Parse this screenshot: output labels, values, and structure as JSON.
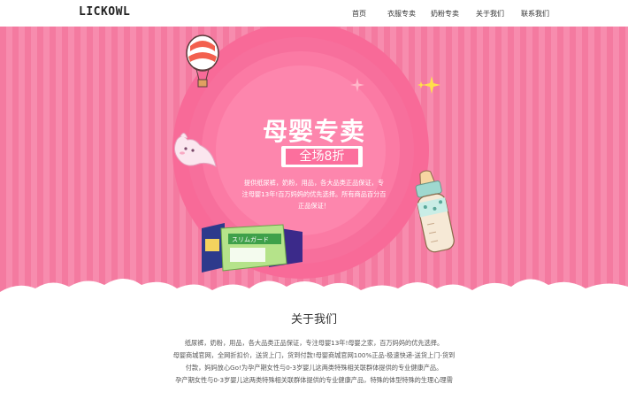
{
  "header": {
    "logo": "LICKOWL",
    "nav": [
      {
        "label": "首页"
      },
      {
        "label": "衣服专卖"
      },
      {
        "label": "奶粉专卖"
      },
      {
        "label": "关于我们"
      },
      {
        "label": "联系我们"
      }
    ]
  },
  "hero": {
    "title": "母婴专卖",
    "promo": "全场8折",
    "description": [
      "提供纸尿裤，奶粉，用品，各大品类正品保证，专",
      "注母婴13年!百万妈妈的优先选择。所有商品百分百",
      "正品保证！"
    ],
    "product_box_text": "スリムガード"
  },
  "about": {
    "title": "关于我们",
    "lines": [
      "纸尿裤，奶粉，用品，各大品类正品保证，专注母婴13年!母婴之家，百万妈妈的优先选择。",
      "母婴商城官网，全网折扣价，送货上门，货到付款!母婴商城官网100%正品-极速快递-送货上门-货到",
      "付款，妈妈放心Go!为孕产期女性与0-3岁婴儿这两类特殊相关联群体提供的专业健康产品。",
      "孕产期女性与0-3岁婴儿这两类特殊相关联群体提供的专业健康产品，特殊的体型特殊的生理心理需"
    ]
  },
  "colors": {
    "hero_pink": "#f47aa0",
    "circle_pink": "#f86a98",
    "promo_pink": "#fc6f9d"
  }
}
